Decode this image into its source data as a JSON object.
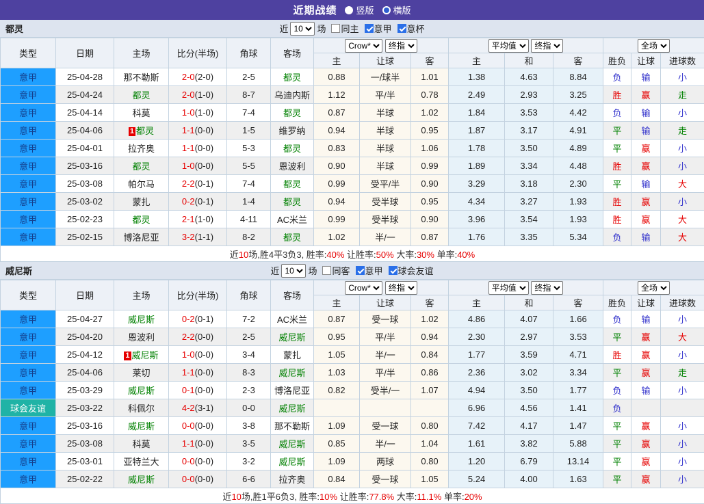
{
  "topbar": {
    "title": "近期战绩",
    "radios": [
      {
        "label": "竖版",
        "checked": false
      },
      {
        "label": "横版",
        "checked": true
      }
    ]
  },
  "controls": {
    "prefix": "近",
    "count": "10",
    "suffix": "场"
  },
  "header_labels": {
    "col_type": "类型",
    "col_date": "日期",
    "col_home": "主场",
    "col_score": "比分(半场)",
    "col_corner": "角球",
    "col_away": "客场",
    "sub": [
      "主",
      "让球",
      "客",
      "主",
      "和",
      "客",
      "胜负",
      "让球",
      "进球数"
    ],
    "selects": {
      "asia_provider": "Crow*",
      "asia_time": "终指",
      "euro_provider": "平均值",
      "euro_time": "终指",
      "scope": "全场"
    }
  },
  "result_color_classes": {
    "胜": "red",
    "赢": "red",
    "大": "red",
    "平": "green",
    "走": "green",
    "负": "blue",
    "输": "blue",
    "小": "blue"
  },
  "colors": {
    "accent_purple": "#4e41a0",
    "league_blue": "#1e9fff",
    "friendly_teal": "#1fb3a6",
    "team_green": "#008000",
    "score_red": "#e60000",
    "win_red": "#e60000",
    "draw_green": "#008000",
    "lose_blue": "#3333cc"
  },
  "sections": [
    {
      "team": "都灵",
      "checkboxes": [
        {
          "label": "同主",
          "checked": false
        },
        {
          "label": "意甲",
          "checked": true
        },
        {
          "label": "意杯",
          "checked": true
        }
      ],
      "rows": [
        {
          "type": "意甲",
          "friendly": false,
          "date": "25-04-28",
          "home": "那不勒斯",
          "home_green": false,
          "home_redcard": 0,
          "score": "2-0",
          "half": "(2-0)",
          "corner": "2-5",
          "away": "都灵",
          "away_green": true,
          "asia": [
            "0.88",
            "一/球半",
            "1.01"
          ],
          "euro": [
            "1.38",
            "4.63",
            "8.84"
          ],
          "results": [
            "负",
            "输",
            "小"
          ]
        },
        {
          "type": "意甲",
          "friendly": false,
          "date": "25-04-24",
          "home": "都灵",
          "home_green": true,
          "home_redcard": 0,
          "score": "2-0",
          "half": "(1-0)",
          "corner": "8-7",
          "away": "乌迪内斯",
          "away_green": false,
          "asia": [
            "1.12",
            "平/半",
            "0.78"
          ],
          "euro": [
            "2.49",
            "2.93",
            "3.25"
          ],
          "results": [
            "胜",
            "赢",
            "走"
          ]
        },
        {
          "type": "意甲",
          "friendly": false,
          "date": "25-04-14",
          "home": "科莫",
          "home_green": false,
          "home_redcard": 0,
          "score": "1-0",
          "half": "(1-0)",
          "corner": "7-4",
          "away": "都灵",
          "away_green": true,
          "asia": [
            "0.87",
            "半球",
            "1.02"
          ],
          "euro": [
            "1.84",
            "3.53",
            "4.42"
          ],
          "results": [
            "负",
            "输",
            "小"
          ]
        },
        {
          "type": "意甲",
          "friendly": false,
          "date": "25-04-06",
          "home": "都灵",
          "home_green": true,
          "home_redcard": 1,
          "score": "1-1",
          "half": "(0-0)",
          "corner": "1-5",
          "away": "维罗纳",
          "away_green": false,
          "asia": [
            "0.94",
            "半球",
            "0.95"
          ],
          "euro": [
            "1.87",
            "3.17",
            "4.91"
          ],
          "results": [
            "平",
            "输",
            "走"
          ]
        },
        {
          "type": "意甲",
          "friendly": false,
          "date": "25-04-01",
          "home": "拉齐奥",
          "home_green": false,
          "home_redcard": 0,
          "score": "1-1",
          "half": "(0-0)",
          "corner": "5-3",
          "away": "都灵",
          "away_green": true,
          "asia": [
            "0.83",
            "半球",
            "1.06"
          ],
          "euro": [
            "1.78",
            "3.50",
            "4.89"
          ],
          "results": [
            "平",
            "赢",
            "小"
          ]
        },
        {
          "type": "意甲",
          "friendly": false,
          "date": "25-03-16",
          "home": "都灵",
          "home_green": true,
          "home_redcard": 0,
          "score": "1-0",
          "half": "(0-0)",
          "corner": "5-5",
          "away": "恩波利",
          "away_green": false,
          "asia": [
            "0.90",
            "半球",
            "0.99"
          ],
          "euro": [
            "1.89",
            "3.34",
            "4.48"
          ],
          "results": [
            "胜",
            "赢",
            "小"
          ]
        },
        {
          "type": "意甲",
          "friendly": false,
          "date": "25-03-08",
          "home": "帕尔马",
          "home_green": false,
          "home_redcard": 0,
          "score": "2-2",
          "half": "(0-1)",
          "corner": "7-4",
          "away": "都灵",
          "away_green": true,
          "asia": [
            "0.99",
            "受平/半",
            "0.90"
          ],
          "euro": [
            "3.29",
            "3.18",
            "2.30"
          ],
          "results": [
            "平",
            "输",
            "大"
          ]
        },
        {
          "type": "意甲",
          "friendly": false,
          "date": "25-03-02",
          "home": "蒙扎",
          "home_green": false,
          "home_redcard": 0,
          "score": "0-2",
          "half": "(0-1)",
          "corner": "1-4",
          "away": "都灵",
          "away_green": true,
          "asia": [
            "0.94",
            "受半球",
            "0.95"
          ],
          "euro": [
            "4.34",
            "3.27",
            "1.93"
          ],
          "results": [
            "胜",
            "赢",
            "小"
          ]
        },
        {
          "type": "意甲",
          "friendly": false,
          "date": "25-02-23",
          "home": "都灵",
          "home_green": true,
          "home_redcard": 0,
          "score": "2-1",
          "half": "(1-0)",
          "corner": "4-11",
          "away": "AC米兰",
          "away_green": false,
          "asia": [
            "0.99",
            "受半球",
            "0.90"
          ],
          "euro": [
            "3.96",
            "3.54",
            "1.93"
          ],
          "results": [
            "胜",
            "赢",
            "大"
          ]
        },
        {
          "type": "意甲",
          "friendly": false,
          "date": "25-02-15",
          "home": "博洛尼亚",
          "home_green": false,
          "home_redcard": 0,
          "score": "3-2",
          "half": "(1-1)",
          "corner": "8-2",
          "away": "都灵",
          "away_green": true,
          "asia": [
            "1.02",
            "半/一",
            "0.87"
          ],
          "euro": [
            "1.76",
            "3.35",
            "5.34"
          ],
          "results": [
            "负",
            "输",
            "大"
          ]
        }
      ],
      "summary": [
        {
          "t": "近"
        },
        {
          "t": "10",
          "r": true
        },
        {
          "t": "场,胜4平3负3, 胜率:"
        },
        {
          "t": "40%",
          "r": true
        },
        {
          "t": " 让胜率:"
        },
        {
          "t": "50%",
          "r": true
        },
        {
          "t": " 大率:"
        },
        {
          "t": "30%",
          "r": true
        },
        {
          "t": " 单率:"
        },
        {
          "t": "40%",
          "r": true
        }
      ]
    },
    {
      "team": "威尼斯",
      "checkboxes": [
        {
          "label": "同客",
          "checked": false
        },
        {
          "label": "意甲",
          "checked": true
        },
        {
          "label": "球会友谊",
          "checked": true
        }
      ],
      "rows": [
        {
          "type": "意甲",
          "friendly": false,
          "date": "25-04-27",
          "home": "威尼斯",
          "home_green": true,
          "home_redcard": 0,
          "score": "0-2",
          "half": "(0-1)",
          "corner": "7-2",
          "away": "AC米兰",
          "away_green": false,
          "asia": [
            "0.87",
            "受一球",
            "1.02"
          ],
          "euro": [
            "4.86",
            "4.07",
            "1.66"
          ],
          "results": [
            "负",
            "输",
            "小"
          ]
        },
        {
          "type": "意甲",
          "friendly": false,
          "date": "25-04-20",
          "home": "恩波利",
          "home_green": false,
          "home_redcard": 0,
          "score": "2-2",
          "half": "(0-0)",
          "corner": "2-5",
          "away": "威尼斯",
          "away_green": true,
          "asia": [
            "0.95",
            "平/半",
            "0.94"
          ],
          "euro": [
            "2.30",
            "2.97",
            "3.53"
          ],
          "results": [
            "平",
            "赢",
            "大"
          ]
        },
        {
          "type": "意甲",
          "friendly": false,
          "date": "25-04-12",
          "home": "威尼斯",
          "home_green": true,
          "home_redcard": 1,
          "score": "1-0",
          "half": "(0-0)",
          "corner": "3-4",
          "away": "蒙扎",
          "away_green": false,
          "asia": [
            "1.05",
            "半/一",
            "0.84"
          ],
          "euro": [
            "1.77",
            "3.59",
            "4.71"
          ],
          "results": [
            "胜",
            "赢",
            "小"
          ]
        },
        {
          "type": "意甲",
          "friendly": false,
          "date": "25-04-06",
          "home": "莱切",
          "home_green": false,
          "home_redcard": 0,
          "score": "1-1",
          "half": "(0-0)",
          "corner": "8-3",
          "away": "威尼斯",
          "away_green": true,
          "asia": [
            "1.03",
            "平/半",
            "0.86"
          ],
          "euro": [
            "2.36",
            "3.02",
            "3.34"
          ],
          "results": [
            "平",
            "赢",
            "走"
          ]
        },
        {
          "type": "意甲",
          "friendly": false,
          "date": "25-03-29",
          "home": "威尼斯",
          "home_green": true,
          "home_redcard": 0,
          "score": "0-1",
          "half": "(0-0)",
          "corner": "2-3",
          "away": "博洛尼亚",
          "away_green": false,
          "asia": [
            "0.82",
            "受半/一",
            "1.07"
          ],
          "euro": [
            "4.94",
            "3.50",
            "1.77"
          ],
          "results": [
            "负",
            "输",
            "小"
          ]
        },
        {
          "type": "球会友谊",
          "friendly": true,
          "date": "25-03-22",
          "home": "科佩尔",
          "home_green": false,
          "home_redcard": 0,
          "score": "4-2",
          "half": "(3-1)",
          "corner": "0-0",
          "away": "威尼斯",
          "away_green": true,
          "asia": [
            "",
            "",
            ""
          ],
          "euro": [
            "6.96",
            "4.56",
            "1.41"
          ],
          "results": [
            "负",
            "",
            ""
          ]
        },
        {
          "type": "意甲",
          "friendly": false,
          "date": "25-03-16",
          "home": "威尼斯",
          "home_green": true,
          "home_redcard": 0,
          "score": "0-0",
          "half": "(0-0)",
          "corner": "3-8",
          "away": "那不勒斯",
          "away_green": false,
          "asia": [
            "1.09",
            "受一球",
            "0.80"
          ],
          "euro": [
            "7.42",
            "4.17",
            "1.47"
          ],
          "results": [
            "平",
            "赢",
            "小"
          ]
        },
        {
          "type": "意甲",
          "friendly": false,
          "date": "25-03-08",
          "home": "科莫",
          "home_green": false,
          "home_redcard": 0,
          "score": "1-1",
          "half": "(0-0)",
          "corner": "3-5",
          "away": "威尼斯",
          "away_green": true,
          "asia": [
            "0.85",
            "半/一",
            "1.04"
          ],
          "euro": [
            "1.61",
            "3.82",
            "5.88"
          ],
          "results": [
            "平",
            "赢",
            "小"
          ]
        },
        {
          "type": "意甲",
          "friendly": false,
          "date": "25-03-01",
          "home": "亚特兰大",
          "home_green": false,
          "home_redcard": 0,
          "score": "0-0",
          "half": "(0-0)",
          "corner": "3-2",
          "away": "威尼斯",
          "away_green": true,
          "asia": [
            "1.09",
            "两球",
            "0.80"
          ],
          "euro": [
            "1.20",
            "6.79",
            "13.14"
          ],
          "results": [
            "平",
            "赢",
            "小"
          ]
        },
        {
          "type": "意甲",
          "friendly": false,
          "date": "25-02-22",
          "home": "威尼斯",
          "home_green": true,
          "home_redcard": 0,
          "score": "0-0",
          "half": "(0-0)",
          "corner": "6-6",
          "away": "拉齐奥",
          "away_green": false,
          "asia": [
            "0.84",
            "受一球",
            "1.05"
          ],
          "euro": [
            "5.24",
            "4.00",
            "1.63"
          ],
          "results": [
            "平",
            "赢",
            "小"
          ]
        }
      ],
      "summary": [
        {
          "t": "近"
        },
        {
          "t": "10",
          "r": true
        },
        {
          "t": "场,胜1平6负3, 胜率:"
        },
        {
          "t": "10%",
          "r": true
        },
        {
          "t": " 让胜率:"
        },
        {
          "t": "77.8%",
          "r": true
        },
        {
          "t": " 大率:"
        },
        {
          "t": "11.1%",
          "r": true
        },
        {
          "t": " 单率:"
        },
        {
          "t": "20%",
          "r": true
        }
      ]
    }
  ]
}
